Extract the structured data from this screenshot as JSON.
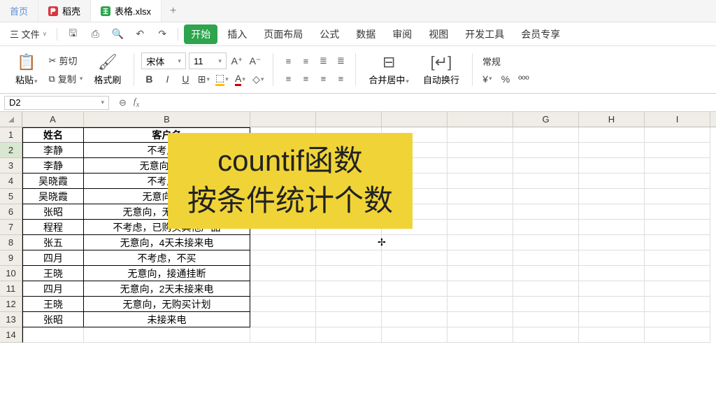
{
  "tabs": {
    "home": "首页",
    "docer": "稻壳",
    "file": "表格.xlsx"
  },
  "toolbar": {
    "menu": "三 文件",
    "start": "开始",
    "insert": "插入",
    "layout": "页面布局",
    "formula": "公式",
    "data": "数据",
    "review": "审阅",
    "view": "视图",
    "devtools": "开发工具",
    "member": "会员专享"
  },
  "ribbon": {
    "paste": "粘贴",
    "cut": "剪切",
    "copy": "复制",
    "format_painter": "格式刷",
    "font": "宋体",
    "size": "11",
    "merge": "合并居中",
    "wrap": "自动换行",
    "numfmt": "常规"
  },
  "namebox": "D2",
  "columns": [
    "A",
    "B",
    "G",
    "H",
    "I"
  ],
  "headers": {
    "a": "姓名",
    "b": "客户名"
  },
  "rows": [
    {
      "n": "1",
      "a": "姓名",
      "b": "客户名",
      "hdr": true
    },
    {
      "n": "2",
      "a": "李静",
      "b": "不考虑，"
    },
    {
      "n": "3",
      "a": "李静",
      "b": "无意向，3天"
    },
    {
      "n": "4",
      "a": "吴晓霞",
      "b": "不考虑，"
    },
    {
      "n": "5",
      "a": "吴晓霞",
      "b": "无意向，接"
    },
    {
      "n": "6",
      "a": "张昭",
      "b": "无意向，无购买意向"
    },
    {
      "n": "7",
      "a": "程程",
      "b": "不考虑，已购买其他产品"
    },
    {
      "n": "8",
      "a": "张五",
      "b": "无意向，4天未接来电"
    },
    {
      "n": "9",
      "a": "四月",
      "b": "不考虑，不买"
    },
    {
      "n": "10",
      "a": "王晓",
      "b": "无意向，接通挂断"
    },
    {
      "n": "11",
      "a": "四月",
      "b": "无意向，2天未接来电"
    },
    {
      "n": "12",
      "a": "王晓",
      "b": "无意向，无购买计划"
    },
    {
      "n": "13",
      "a": "张昭",
      "b": "未接来电"
    },
    {
      "n": "14",
      "a": "",
      "b": "",
      "empty": true
    }
  ],
  "annotation": {
    "line1": "countif函数",
    "line2": "按条件统计个数"
  }
}
